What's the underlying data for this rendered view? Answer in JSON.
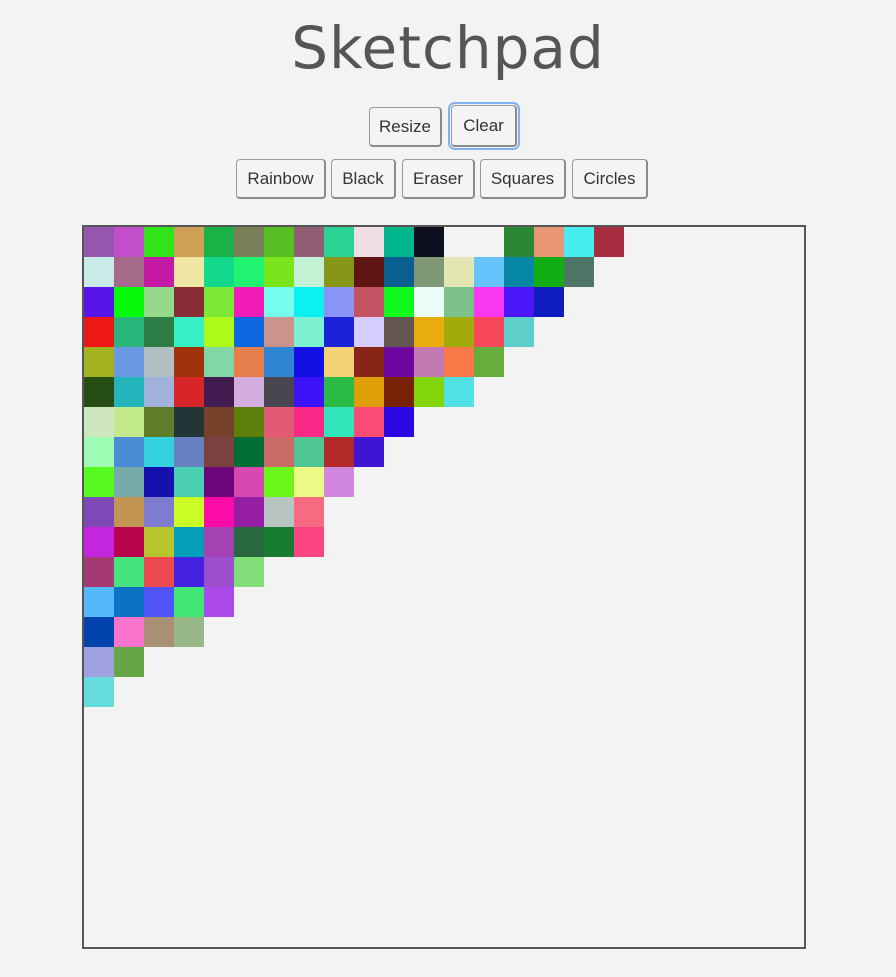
{
  "app": {
    "title": "Sketchpad"
  },
  "toolbar_top": {
    "resize_label": "Resize",
    "clear_label": "Clear"
  },
  "toolbar_modes": {
    "rainbow_label": "Rainbow",
    "black_label": "Black",
    "eraser_label": "Eraser",
    "squares_label": "Squares",
    "circles_label": "Circles"
  },
  "board": {
    "painted_rows": [
      [
        "#9556ad",
        "#c24fc9",
        "#30e419",
        "#cf9f58",
        "#1ab146",
        "#7a7f58",
        "#58c024",
        "#905e75",
        "#2ad394",
        "#efdde5",
        "#00b68c",
        "#0e101f",
        null,
        null,
        "#2a8834",
        "#e99674",
        "#47eef0",
        "#a72c40"
      ],
      [
        "#c8ebe8",
        "#a5698a",
        "#c319a5",
        "#eee6a2",
        "#12d98b",
        "#21f471",
        "#7ae41c",
        "#c3f1d4",
        "#889617",
        "#5f1513",
        "#0a5f8f",
        "#7f9875",
        "#e2e6b3",
        "#66c4fd",
        "#0587a5",
        "#12ac13",
        "#4f7568"
      ],
      [
        "#5815e8",
        "#08fa0b",
        "#96d98c",
        "#862d35",
        "#7ee836",
        "#f21cb9",
        "#75fcec",
        "#0bf1f3",
        "#8894f6",
        "#c55262",
        "#10fa20",
        "#edfbf6",
        "#7cc08b",
        "#fa38f3",
        "#4d16f9",
        "#0e1bbd"
      ],
      [
        "#ed1717",
        "#2ab57b",
        "#2e7c46",
        "#35efc5",
        "#adfa19",
        "#0c68e0",
        "#ca938b",
        "#7ff0cf",
        "#1c22d7",
        "#d5cdfd",
        "#635651",
        "#e8ac0f",
        "#a2ab09",
        "#f6475b",
        "#5ecfcb"
      ],
      [
        "#a4b221",
        "#6b9ae5",
        "#b2bfc2",
        "#a1330c",
        "#82d8a4",
        "#e57e4a",
        "#2f85d1",
        "#120fe4",
        "#f3d175",
        "#892418",
        "#6d07a0",
        "#c379b4",
        "#f87848",
        "#65ae3e"
      ],
      [
        "#264e14",
        "#23b4bc",
        "#a2b3db",
        "#d72528",
        "#421b50",
        "#d3ace0",
        "#4a4650",
        "#3c13f8",
        "#2aba45",
        "#dd9e07",
        "#772206",
        "#82d50b",
        "#4fe1e3"
      ],
      [
        "#cde6be",
        "#c3ea8a",
        "#5e7c29",
        "#223537",
        "#764029",
        "#5e7f0a",
        "#e15973",
        "#fa2787",
        "#32e6bc",
        "#fb4a73",
        "#2a07e2"
      ],
      [
        "#9efbb4",
        "#4b8cd6",
        "#34d2e0",
        "#6781c1",
        "#7b4140",
        "#016d33",
        "#ca6b66",
        "#4fc795",
        "#b32a2b",
        "#3d15d2"
      ],
      [
        "#57fa1f",
        "#76aaab",
        "#1511ae",
        "#4acfb0",
        "#6c057a",
        "#d846b0",
        "#6af81a",
        "#edfa85",
        "#d187dd"
      ],
      [
        "#8047b6",
        "#c29553",
        "#7d7ccf",
        "#cafc26",
        "#fd0ba7",
        "#961ea4",
        "#b8c5c2",
        "#f66b82"
      ],
      [
        "#c526e0",
        "#b7044d",
        "#b6c42e",
        "#059fbb",
        "#a442b3",
        "#27683c",
        "#187c30",
        "#fb4583"
      ],
      [
        "#a53974",
        "#45e47e",
        "#ec4951",
        "#4522e2",
        "#9b4fcc",
        "#81de79"
      ],
      [
        "#53b9fb",
        "#0d71c4",
        "#5053f7",
        "#42e672",
        "#aa48ea"
      ],
      [
        "#0242ac",
        "#fa73cc",
        "#aa9175",
        "#98b786"
      ],
      [
        "#a0a1e0",
        "#67a644"
      ],
      [
        "#65dcdc"
      ]
    ]
  }
}
